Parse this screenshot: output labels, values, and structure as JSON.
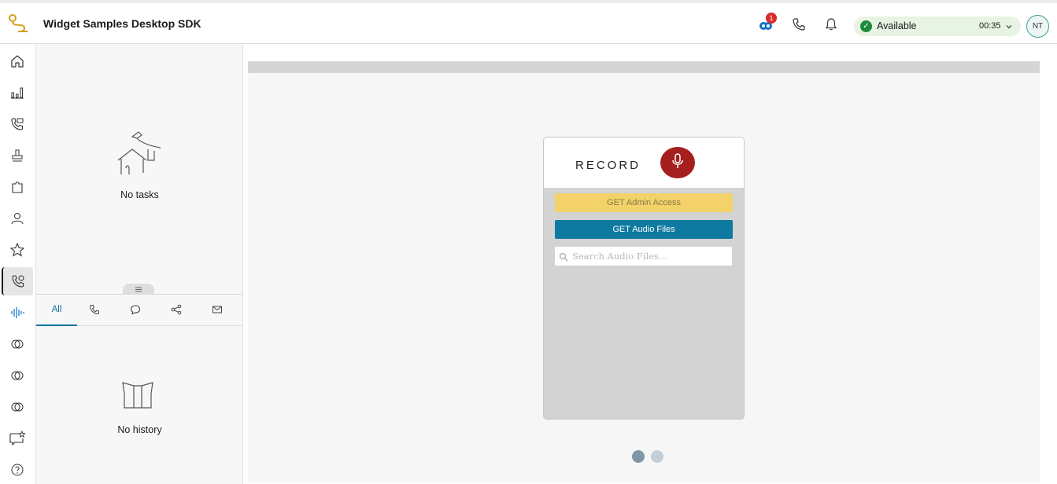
{
  "header": {
    "app_title": "Widget Samples Desktop SDK",
    "notification_badge": "1",
    "agent_state": {
      "label": "Available",
      "timer": "00:35",
      "status_color": "#1f8a3a"
    },
    "avatar_initials": "NT",
    "icons": [
      "logo-icon",
      "connector-icon",
      "phone-icon",
      "bell-icon",
      "chevron-down-icon"
    ]
  },
  "left_nav": {
    "items": [
      "home-icon",
      "bar-chart-icon",
      "phone-list-icon",
      "stamp-icon",
      "puzzle-icon",
      "contact-icon",
      "star-icon",
      "widget-icon",
      "waveform-icon",
      "rings-icon",
      "rings-icon",
      "rings-icon",
      "chat-star-icon",
      "help-icon"
    ],
    "active_index": 7
  },
  "tasks_panel": {
    "empty_text": "No tasks"
  },
  "history_panel": {
    "tabs": [
      "All",
      "phone-icon",
      "chat-icon",
      "share-icon",
      "mail-icon"
    ],
    "active_tab": "All",
    "empty_text": "No history"
  },
  "record_widget": {
    "title": "RECORD",
    "admin_button": "GET Admin Access",
    "audio_button": "GET Audio Files",
    "search_placeholder": "Search Audio Files...",
    "search_value": "",
    "colors": {
      "mic": "#a61f1f",
      "admin_button": "#f2d269",
      "audio_button": "#0f7aa1"
    },
    "pager": {
      "pages": 2,
      "current": 1
    }
  }
}
